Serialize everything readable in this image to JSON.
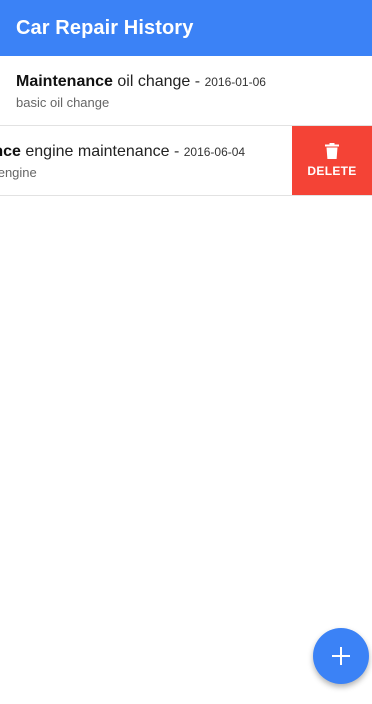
{
  "appbar": {
    "title": "Car Repair History",
    "color": "#3b82f6"
  },
  "records": [
    {
      "category": "Maintenance",
      "title": "oil change",
      "separator": "-",
      "date": "2016-01-06",
      "notes": "basic oil change"
    },
    {
      "category": "Maintenance",
      "title": "engine maintenance",
      "separator": "-",
      "date": "2016-06-04",
      "notes": "checked the engine"
    }
  ],
  "row_action": {
    "label": "DELETE",
    "icon": "trash-icon",
    "color": "#f44336"
  },
  "fab": {
    "icon": "plus-icon",
    "color": "#3b82f6"
  }
}
